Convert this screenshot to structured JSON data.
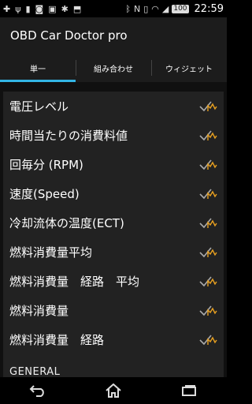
{
  "status_bar": {
    "left_icons": [
      "plus-icon",
      "usb-icon",
      "battery-alert-icon",
      "camera-icon",
      "photo-icon",
      "debug-icon",
      "data-icon"
    ],
    "battery": "100",
    "time": "22:59"
  },
  "app": {
    "title": "OBD Car Doctor pro"
  },
  "tabs": [
    {
      "label": "単一",
      "selected": true
    },
    {
      "label": "組み合わせ",
      "selected": false
    },
    {
      "label": "ウィジェット",
      "selected": false
    }
  ],
  "rows": [
    {
      "label": "電圧レベル",
      "checked": true
    },
    {
      "label": "時間当たりの消費料値",
      "checked": true
    },
    {
      "label": "回毎分 (RPM)",
      "checked": true
    },
    {
      "label": "速度(Speed)",
      "checked": true
    },
    {
      "label": "冷却流体の温度(ECT)",
      "checked": true
    },
    {
      "label": "燃料消費量平均",
      "checked": true
    },
    {
      "label": "燃料消費量　経路　平均",
      "checked": true
    },
    {
      "label": "燃料消費量",
      "checked": true
    },
    {
      "label": "燃料消費量　経路",
      "checked": true
    }
  ],
  "section": {
    "label": "GENERAL"
  },
  "nav": {
    "back": "back-icon",
    "home": "home-icon",
    "recents": "recents-icon"
  },
  "colors": {
    "accent": "#33b5e5",
    "check": "#e8a020"
  }
}
